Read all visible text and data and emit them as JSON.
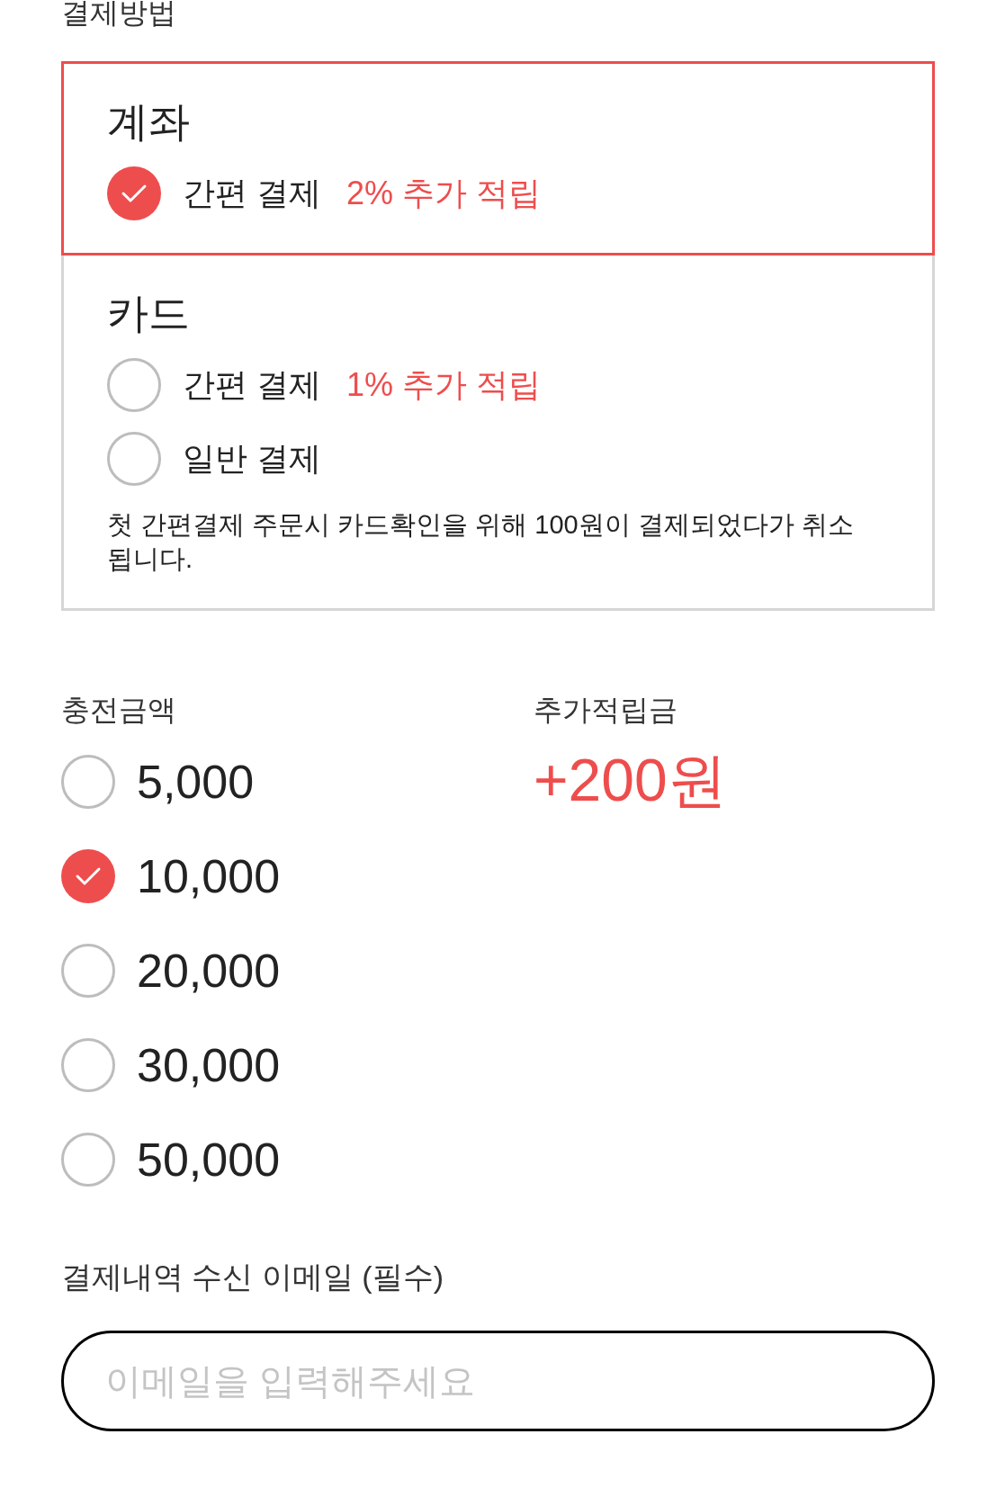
{
  "payment_method": {
    "title": "결제방법",
    "groups": [
      {
        "title": "계좌",
        "selected": true,
        "options": [
          {
            "label": "간편 결제",
            "bonus": "2% 추가 적립",
            "selected": true
          }
        ]
      },
      {
        "title": "카드",
        "selected": false,
        "options": [
          {
            "label": "간편 결제",
            "bonus": "1% 추가 적립",
            "selected": false
          },
          {
            "label": "일반 결제",
            "selected": false
          }
        ],
        "note": "첫 간편결제 주문시 카드확인을 위해 100원이 결제되었다가 취소됩니다."
      }
    ]
  },
  "charge": {
    "title": "충전금액",
    "options": [
      {
        "label": "5,000",
        "selected": false
      },
      {
        "label": "10,000",
        "selected": true
      },
      {
        "label": "20,000",
        "selected": false
      },
      {
        "label": "30,000",
        "selected": false
      },
      {
        "label": "50,000",
        "selected": false
      }
    ]
  },
  "bonus": {
    "title": "추가적립금",
    "value": "+200원"
  },
  "email": {
    "label": "결제내역 수신 이메일 (필수)",
    "placeholder": "이메일을 입력해주세요"
  }
}
